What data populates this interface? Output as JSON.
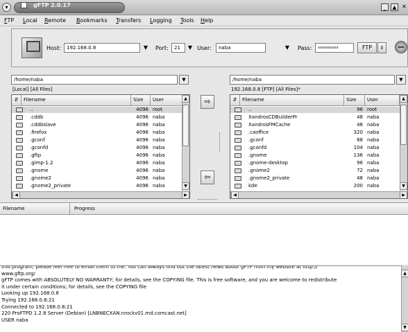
{
  "window": {
    "title": "gFTP 2.0.17"
  },
  "menu": [
    "FTP",
    "Local",
    "Remote",
    "Bookmarks",
    "Transfers",
    "Logging",
    "Tools",
    "Help"
  ],
  "connection": {
    "host_label": "Host:",
    "host": "192.168.0.8",
    "port_label": "Port:",
    "port": "21",
    "user_label": "User:",
    "user": "naba",
    "pass_label": "Pass:",
    "pass": "xxxxxxxxxx",
    "protocol": "FTP"
  },
  "local": {
    "path": "/home/naba",
    "subtitle": "[Local] [All Files]",
    "columns": {
      "name": "Filename",
      "size": "Size",
      "user": "User"
    },
    "files": [
      {
        "name": "..",
        "size": "4096",
        "user": "root"
      },
      {
        "name": ".cddb",
        "size": "4096",
        "user": "naba"
      },
      {
        "name": ".cddbslave",
        "size": "4096",
        "user": "naba"
      },
      {
        "name": ".firefox",
        "size": "4096",
        "user": "naba"
      },
      {
        "name": ".gconf",
        "size": "4096",
        "user": "naba"
      },
      {
        "name": ".gconfd",
        "size": "4096",
        "user": "naba"
      },
      {
        "name": ".gftp",
        "size": "4096",
        "user": "naba"
      },
      {
        "name": ".gimp-1.2",
        "size": "4096",
        "user": "naba"
      },
      {
        "name": ".gnome",
        "size": "4096",
        "user": "naba"
      },
      {
        "name": ".gnome2",
        "size": "4096",
        "user": "naba"
      },
      {
        "name": ".gnome2_private",
        "size": "4096",
        "user": "naba"
      }
    ]
  },
  "remote": {
    "path": "/home/naba",
    "subtitle": "192.168.0.8 [FTP] [All Files]*",
    "columns": {
      "name": "Filename",
      "size": "Size",
      "user": "User"
    },
    "files": [
      {
        "name": "..",
        "size": "96",
        "user": "root"
      },
      {
        "name": "XandrosCDBuilderPr",
        "size": "48",
        "user": "naba"
      },
      {
        "name": "XandrosFMCache",
        "size": "48",
        "user": "naba"
      },
      {
        "name": ".cxoffice",
        "size": "320",
        "user": "naba"
      },
      {
        "name": ".gconf",
        "size": "88",
        "user": "naba"
      },
      {
        "name": ".gconfd",
        "size": "104",
        "user": "naba"
      },
      {
        "name": ".gnome",
        "size": "136",
        "user": "naba"
      },
      {
        "name": ".gnome-desktop",
        "size": "96",
        "user": "naba"
      },
      {
        "name": ".gnome2",
        "size": "72",
        "user": "naba"
      },
      {
        "name": ".gnome2_private",
        "size": "48",
        "user": "naba"
      },
      {
        "name": "kde",
        "size": "200",
        "user": "naba"
      }
    ]
  },
  "transfers": {
    "col_filename": "Filename",
    "col_progress": "Progress"
  },
  "log": [
    "this program, please feel free to email them to me. You can always find out the latest news about gFTP from my website at http://",
    "www.gftp.org/",
    "gFTP comes with ABSOLUTELY NO WARRANTY; for details, see the COPYING file. This is free software, and you are welcome to redistribute",
    "it under certain conditions; for details, see the COPYING file",
    "Looking up 192.168.0.8",
    "Trying 192.168.0.8:21",
    "Connected to 192.168.0.8:21",
    "220 ProFTPD 1.2.8 Server (Debian) [LNBNECXAN.nrockv01.md.comcast.net]",
    "USER naba"
  ]
}
